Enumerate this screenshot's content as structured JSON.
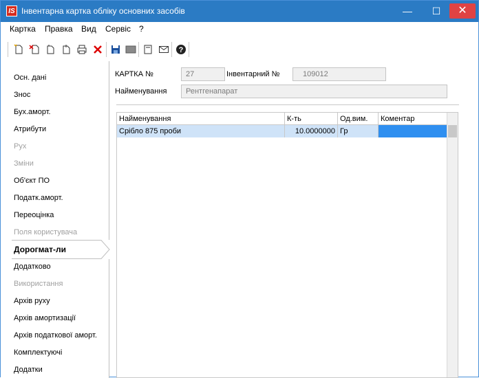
{
  "window": {
    "title": "Інвентарна картка обліку основних засобів",
    "logo_text": "IS",
    "controls": {
      "minimize": "—",
      "maximize": "☐",
      "close": "✕"
    }
  },
  "menu": [
    "Картка",
    "Правка",
    "Вид",
    "Сервіс",
    "?"
  ],
  "toolbar": {
    "buttons": [
      "new-doc-icon",
      "delete-doc-icon",
      "copy-doc-icon",
      "paste-doc-icon",
      "print-icon",
      "delete-icon",
      "save-icon",
      "screen-icon",
      "card-icon",
      "mail-icon",
      "help-icon"
    ]
  },
  "sidebar": {
    "items": [
      {
        "label": "Осн. дані",
        "state": "normal"
      },
      {
        "label": "Знос",
        "state": "normal"
      },
      {
        "label": "Бух.аморт.",
        "state": "normal"
      },
      {
        "label": "Атрибути",
        "state": "normal"
      },
      {
        "label": "Рух",
        "state": "disabled"
      },
      {
        "label": "Зміни",
        "state": "disabled"
      },
      {
        "label": "Об'єкт ПО",
        "state": "normal"
      },
      {
        "label": "Податк.аморт.",
        "state": "normal"
      },
      {
        "label": "Переоцінка",
        "state": "normal"
      },
      {
        "label": "Поля користувача",
        "state": "disabled"
      },
      {
        "label": "Дорогмат-ли",
        "state": "active"
      },
      {
        "label": "Додатково",
        "state": "normal"
      },
      {
        "label": "Використання",
        "state": "disabled"
      },
      {
        "label": "Архів руху",
        "state": "normal"
      },
      {
        "label": "Архів амортизації",
        "state": "normal"
      },
      {
        "label": "Архів податкової аморт.",
        "state": "normal"
      },
      {
        "label": "Комплектуючі",
        "state": "normal"
      },
      {
        "label": "Додатки",
        "state": "normal"
      }
    ]
  },
  "form": {
    "card_label": "КАРТКА №",
    "card_value": "27",
    "inv_label": "Інвентарний №",
    "inv_value": "109012",
    "name_label": "Найменування",
    "name_value": "Рентгенапарат"
  },
  "grid": {
    "columns": [
      "Найменування",
      "К-ть",
      "Од.вим.",
      "Коментар"
    ],
    "rows": [
      [
        "Срібло 875 проби",
        "10.0000000",
        "Гр",
        ""
      ]
    ]
  },
  "colors": {
    "titlebar": "#2b7bc4",
    "close": "#e04343",
    "row_highlight": "#cfe3f8",
    "cell_selected": "#2f8ff0"
  }
}
